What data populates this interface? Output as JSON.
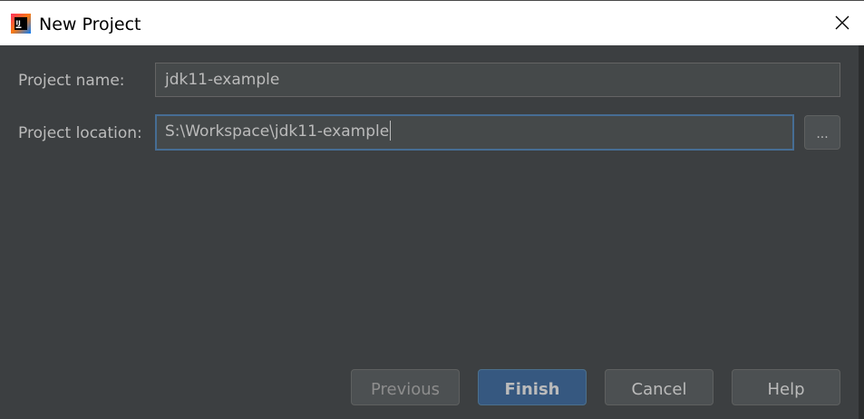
{
  "window": {
    "title": "New Project",
    "app_icon_text": "IJ"
  },
  "form": {
    "project_name_label": "Project name:",
    "project_name_value": "jdk11-example",
    "project_location_label": "Project location:",
    "project_location_value": "S:\\Workspace\\jdk11-example",
    "browse_label": "..."
  },
  "buttons": {
    "previous": "Previous",
    "finish": "Finish",
    "cancel": "Cancel",
    "help": "Help"
  },
  "colors": {
    "background": "#3c3f41",
    "field_bg": "#45494a",
    "primary_button": "#365880",
    "focus_border": "#466d94",
    "text": "#bbbbbb"
  },
  "icons": {
    "app": "intellij-idea-icon",
    "close": "close-icon"
  }
}
